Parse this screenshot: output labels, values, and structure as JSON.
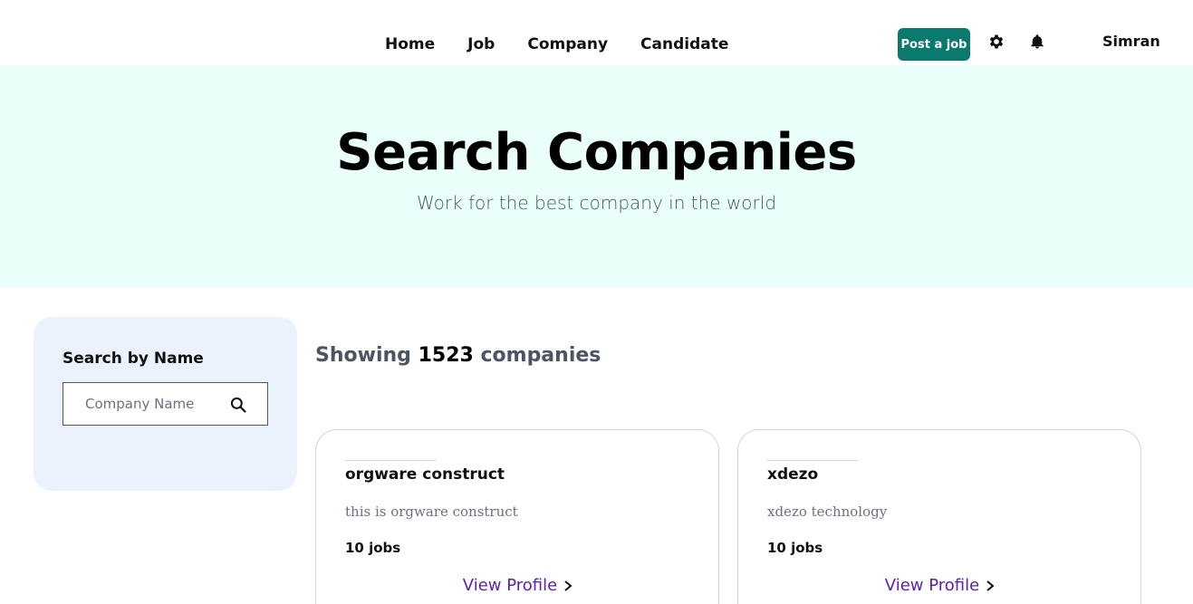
{
  "nav": {
    "links": [
      "Home",
      "Job",
      "Company",
      "Candidate"
    ],
    "post_job_label": "Post a job",
    "user_name": "Simran",
    "icons": [
      "gear-icon",
      "bell-icon"
    ]
  },
  "hero": {
    "title": "Search Companies",
    "subtitle": "Work for the best company in the world",
    "background": "#eafff9"
  },
  "sidebar": {
    "title": "Search by Name",
    "search_placeholder": "Company Name",
    "search_value": "",
    "background": "#eaf3fd"
  },
  "results": {
    "prefix": "Showing",
    "count": "1523",
    "suffix": "companies"
  },
  "companies": [
    {
      "name": "orgware construct",
      "description": "this is orgware construct",
      "jobs": "10 jobs",
      "link_label": "View Profile"
    },
    {
      "name": "xdezo",
      "description": "xdezo technology",
      "jobs": "10 jobs",
      "link_label": "View Profile"
    }
  ],
  "colors": {
    "accent": "#0b7a6e",
    "link": "#5b21b6"
  }
}
